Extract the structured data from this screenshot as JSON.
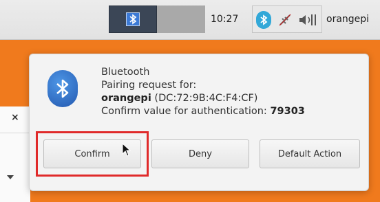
{
  "taskbar": {
    "clock": "10:27",
    "user": "orangepi"
  },
  "notification": {
    "app_name": "Bluetooth",
    "line1": "Pairing request for:",
    "device_name": "orangepi",
    "device_address": " (DC:72:9B:4C:F4:CF)",
    "confirm_prefix": "Confirm value for authentication: ",
    "passkey": "79303",
    "actions": {
      "confirm": "Confirm",
      "deny": "Deny",
      "default": "Default Action"
    }
  },
  "background_window": {
    "close_glyph": "×"
  },
  "colors": {
    "desktop": "#f07a1d",
    "highlight": "#e02a2a",
    "bluetooth": "#3c7ad6"
  },
  "icons": {
    "panel_bluetooth": "bluetooth-icon",
    "tray_bluetooth": "bluetooth-tray-icon",
    "network": "network-disconnected-icon",
    "volume": "volume-icon",
    "notification": "bluetooth-icon",
    "cursor": "mouse-cursor-icon"
  }
}
